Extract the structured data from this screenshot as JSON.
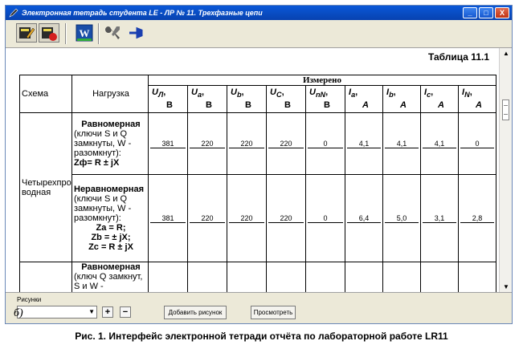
{
  "window": {
    "title": "Электронная тетрадь студента LE - ЛР № 11. Трехфазные цепи",
    "buttons": [
      "_",
      "□",
      "X"
    ]
  },
  "toolbar": {
    "icons": [
      "notebook-edit-icon",
      "notebook-delete-icon",
      "word-icon",
      "tools-icon",
      "pin-icon"
    ]
  },
  "table": {
    "caption": "Таблица 11.1",
    "headers": {
      "scheme": "Схема",
      "load": "Нагрузка",
      "measured": "Измерено",
      "cols": [
        {
          "sym": "U",
          "sub": "Л",
          "unit": "В"
        },
        {
          "sym": "U",
          "sub": "a",
          "unit": "В"
        },
        {
          "sym": "U",
          "sub": "b",
          "unit": "В"
        },
        {
          "sym": "U",
          "sub": "C",
          "unit": "В"
        },
        {
          "sym": "U",
          "sub": "nN",
          "unit": "В"
        },
        {
          "sym": "I",
          "sub": "a",
          "unit": "A"
        },
        {
          "sym": "I",
          "sub": "b",
          "unit": "A"
        },
        {
          "sym": "I",
          "sub": "c",
          "unit": "A"
        },
        {
          "sym": "I",
          "sub": "N",
          "unit": "A"
        }
      ]
    },
    "scheme_name": "Четырехпро водная",
    "rows": [
      {
        "load_title": "Равномерная",
        "load_desc": "(ключи S и Q замкнуты, W - разомкнут):",
        "formula": "Zф= R ± jX",
        "values": [
          "381",
          "220",
          "220",
          "220",
          "0",
          "4,1",
          "4,1",
          "4,1",
          "0"
        ]
      },
      {
        "load_title": "Неравномерная",
        "load_desc": "(ключи S и Q замкнуты, W - разомкнут):",
        "formula_a": "Za = R;",
        "formula_b": "Zb = ± jX;",
        "formula_c": "Zc = R ± jX",
        "values": [
          "381",
          "220",
          "220",
          "220",
          "0",
          "6,4",
          "5,0",
          "3,1",
          "2,8"
        ]
      },
      {
        "load_title": "Равномерная",
        "load_desc": "(ключ Q замкнут, S и W -"
      }
    ]
  },
  "bottom": {
    "group_label": "Рисунки",
    "add_label": "Добавить рисунок",
    "view_label": "Просмотреть",
    "plus": "+",
    "minus": "−"
  },
  "figure_letter": "б)",
  "caption": "Рис. 1.  Интерфейс электронной тетради отчёта по  лабораторной работе LR11"
}
